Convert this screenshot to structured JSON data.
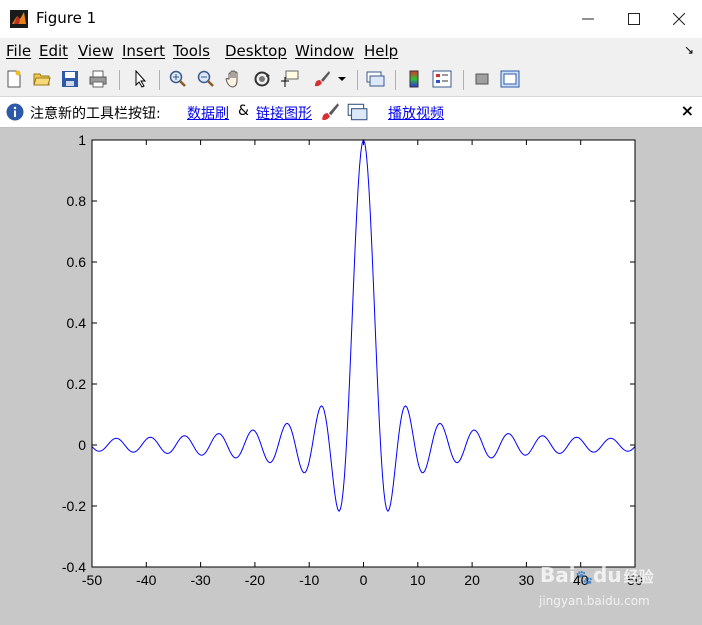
{
  "window": {
    "title": "Figure 1",
    "minimize_icon": "minimize-icon",
    "maximize_icon": "maximize-icon",
    "close_icon": "close-icon"
  },
  "menu": {
    "items": [
      "File",
      "Edit",
      "View",
      "Insert",
      "Tools",
      "Desktop",
      "Window",
      "Help"
    ],
    "dock_arrow": "↘"
  },
  "toolbar": {
    "icons": [
      "new-figure-icon",
      "open-file-icon",
      "save-icon",
      "print-icon",
      "edit-plot-arrow-icon",
      "zoom-in-icon",
      "zoom-out-icon",
      "pan-hand-icon",
      "rotate-3d-icon",
      "data-cursor-icon",
      "brush-icon",
      "brush-dropdown-icon",
      "link-plot-icon",
      "insert-colorbar-icon",
      "insert-legend-icon",
      "hide-plot-tools-icon",
      "show-plot-tools-icon"
    ]
  },
  "infobar": {
    "prefix": "注意新的工具栏按钮:",
    "link_brush": "数据刷",
    "amp": "&",
    "link_plot": "链接图形",
    "link_video": "播放视频",
    "close": "×"
  },
  "colors": {
    "line": "#0000ff",
    "axes_bg": "#ffffff",
    "figure_bg": "#c8c8c8"
  },
  "chart_data": {
    "type": "line",
    "title": "",
    "xlabel": "",
    "ylabel": "",
    "function": "sin(x)/x",
    "x_range": [
      -50,
      50
    ],
    "xlim": [
      -50,
      50
    ],
    "ylim": [
      -0.4,
      1
    ],
    "x_ticks": [
      -50,
      -40,
      -30,
      -20,
      -10,
      0,
      10,
      20,
      30,
      40,
      50
    ],
    "y_ticks": [
      -0.4,
      -0.2,
      0,
      0.2,
      0.4,
      0.6,
      0.8,
      1
    ],
    "x_tick_labels": [
      "-50",
      "-40",
      "-30",
      "-20",
      "-10",
      "0",
      "10",
      "20",
      "30",
      "40",
      "50"
    ],
    "y_tick_labels": [
      "-0.4",
      "-0.2",
      "0",
      "0.2",
      "0.4",
      "0.6",
      "0.8",
      "1"
    ],
    "grid": false,
    "series": [
      {
        "color": "#0000ff",
        "samples": 400
      }
    ]
  },
  "watermark": {
    "text1": "Bai",
    "text2": "du",
    "text3": "经验",
    "url": "jingyan.baidu.com"
  }
}
